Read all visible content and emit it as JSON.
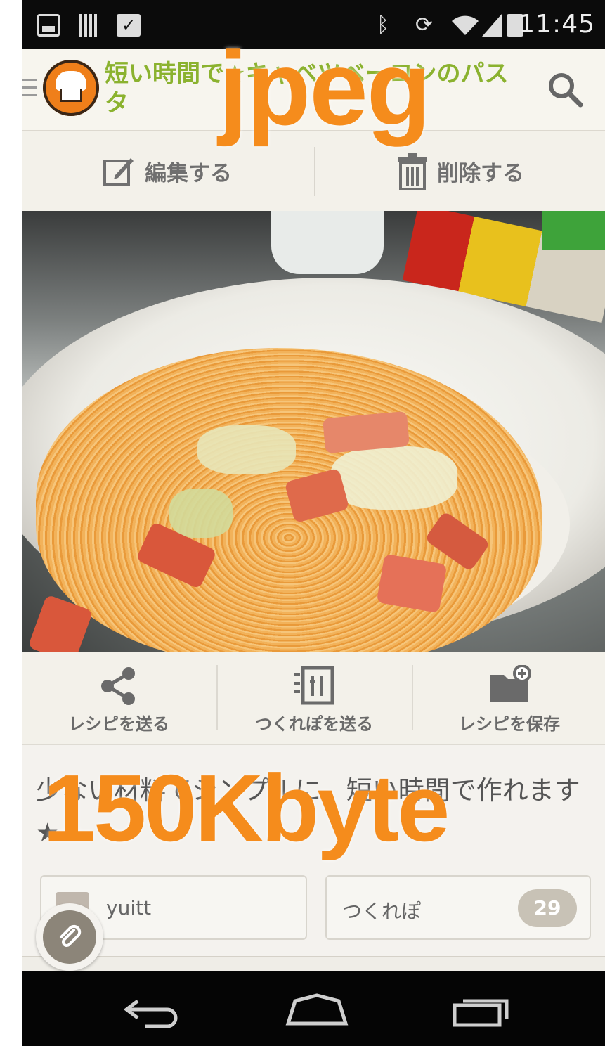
{
  "status_bar": {
    "time": "11:45",
    "icons": [
      "image-icon",
      "barcode-icon",
      "clipboard-check-icon",
      "bluetooth-icon",
      "rotation-icon",
      "wifi-icon",
      "signal-icon",
      "battery-icon"
    ]
  },
  "app_bar": {
    "title": "短い時間で★キャベツベーコンのパスタ",
    "menu_icon": "hamburger-icon",
    "logo": "cookpad-chef-hat-logo",
    "search_icon": "search-icon"
  },
  "overlays": {
    "format_label": "jpeg",
    "size_label": "150Kbyte"
  },
  "actions": {
    "edit": "編集する",
    "delete": "削除する"
  },
  "photo": {
    "subject": "spaghetti with cabbage and bacon"
  },
  "share_bar": {
    "items": [
      {
        "label": "レシピを送る",
        "icon": "share-icon"
      },
      {
        "label": "つくれぽを送る",
        "icon": "tsukurepo-icon"
      },
      {
        "label": "レシピを保存",
        "icon": "folder-add-icon"
      }
    ]
  },
  "description": "少ない材料でシンプルに、短い時間で作れます★",
  "author": {
    "name": "yuitt"
  },
  "tsukurepo": {
    "label": "つくれぽ",
    "count": "29"
  },
  "colors": {
    "brand_orange": "#ef7f1a",
    "title_green": "#8bb22f",
    "overlay_orange": "#f58c1c"
  },
  "nav_bar": {
    "icons": [
      "back-icon",
      "home-icon",
      "recent-apps-icon"
    ]
  }
}
